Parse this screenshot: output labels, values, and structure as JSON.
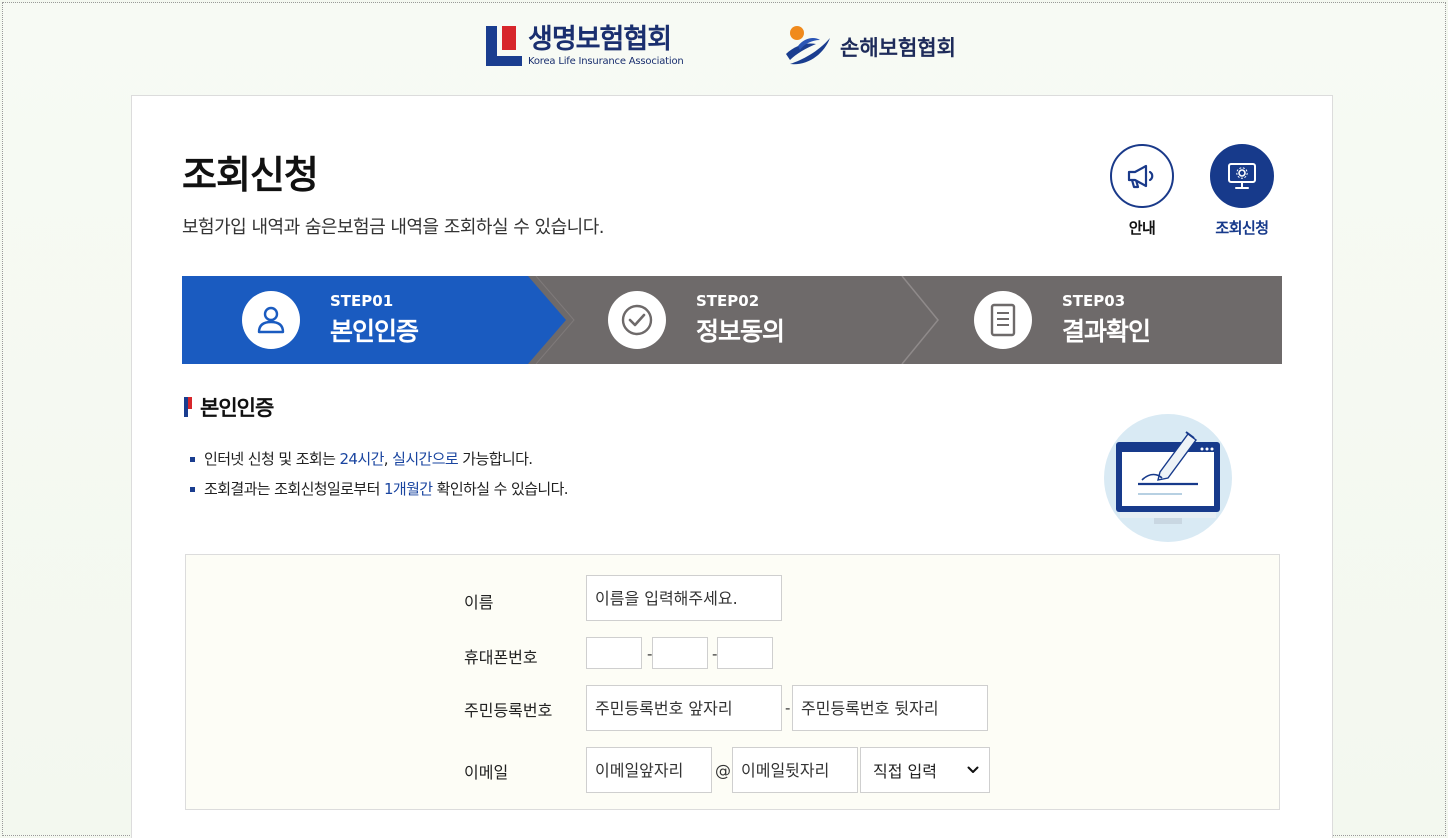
{
  "header": {
    "life_logo_ko": "생명보험협회",
    "life_logo_en": "Korea Life Insurance Association",
    "nonlife_logo_ko": "손해보험협회"
  },
  "page": {
    "title": "조회신청",
    "description": "보험가입 내역과 숨은보험금 내역을 조회하실 수 있습니다."
  },
  "quick_menu": {
    "guide_label": "안내",
    "apply_label": "조회신청"
  },
  "steps": [
    {
      "num": "STEP01",
      "name": "본인인증",
      "active": true
    },
    {
      "num": "STEP02",
      "name": "정보동의",
      "active": false
    },
    {
      "num": "STEP03",
      "name": "결과확인",
      "active": false
    }
  ],
  "section": {
    "title": "본인인증",
    "bullet1": {
      "pre": "인터넷 신청 및 조회는 ",
      "hl1": "24시간",
      "mid": ", ",
      "hl2": "실시간으로",
      "post": " 가능합니다."
    },
    "bullet2": {
      "pre": "조회결과는 조회신청일로부터 ",
      "hl1": "1개월간",
      "post": " 확인하실 수 있습니다."
    }
  },
  "form": {
    "name_label": "이름",
    "name_placeholder": "이름을 입력해주세요.",
    "phone_label": "휴대폰번호",
    "phone_sep": "-",
    "rrn_label": "주민등록번호",
    "rrn_front_placeholder": "주민등록번호 앞자리",
    "rrn_back_placeholder": "주민등록번호 뒷자리",
    "rrn_sep": "-",
    "email_label": "이메일",
    "email_front_placeholder": "이메일앞자리",
    "email_at": "@",
    "email_back_placeholder": "이메일뒷자리",
    "email_domain_selected": "직접 입력"
  },
  "colors": {
    "primary_blue": "#1a5bc0",
    "navy": "#173a8b",
    "step_gray": "#6e6a6a",
    "accent_red": "#d7262b"
  }
}
